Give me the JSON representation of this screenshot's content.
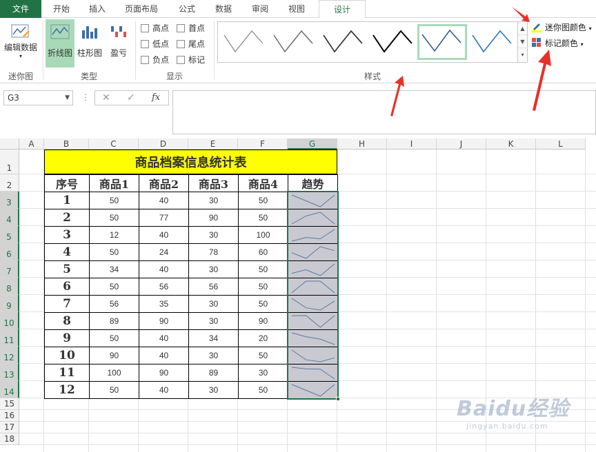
{
  "tabs": [
    "文件",
    "开始",
    "插入",
    "页面布局",
    "公式",
    "数据",
    "审阅",
    "视图",
    "设计"
  ],
  "ribbon": {
    "edit_data": "编辑数据",
    "sparkline_group": "迷你图",
    "type_group": "类型",
    "type_buttons": [
      "折线图",
      "柱形图",
      "盈亏"
    ],
    "show_group": "显示",
    "show_checks": [
      "高点",
      "首点",
      "低点",
      "尾点",
      "负点",
      "标记"
    ],
    "style_group": "样式",
    "sparkline_color": "迷你图颜色",
    "marker_color": "标记颜色"
  },
  "formula_bar": {
    "name_box": "G3",
    "fx": "fx"
  },
  "columns": [
    "A",
    "B",
    "C",
    "D",
    "E",
    "F",
    "G",
    "H",
    "I",
    "J",
    "K",
    "L"
  ],
  "rows": [
    "1",
    "2",
    "3",
    "4",
    "5",
    "6",
    "7",
    "8",
    "9",
    "10",
    "11",
    "12",
    "13",
    "14",
    "15",
    "16",
    "17",
    "18"
  ],
  "table": {
    "title": "商品档案信息统计表",
    "headers": [
      "序号",
      "商品1",
      "商品2",
      "商品3",
      "商品4",
      "趋势"
    ],
    "rows": [
      {
        "seq": "1",
        "v": [
          50,
          40,
          30,
          50
        ]
      },
      {
        "seq": "2",
        "v": [
          50,
          77,
          90,
          50
        ]
      },
      {
        "seq": "3",
        "v": [
          12,
          40,
          30,
          100
        ]
      },
      {
        "seq": "4",
        "v": [
          50,
          24,
          78,
          60
        ]
      },
      {
        "seq": "5",
        "v": [
          34,
          40,
          30,
          50
        ]
      },
      {
        "seq": "6",
        "v": [
          50,
          56,
          56,
          50
        ]
      },
      {
        "seq": "7",
        "v": [
          56,
          35,
          30,
          50
        ]
      },
      {
        "seq": "8",
        "v": [
          89,
          90,
          30,
          90
        ]
      },
      {
        "seq": "9",
        "v": [
          50,
          40,
          34,
          20
        ]
      },
      {
        "seq": "10",
        "v": [
          90,
          40,
          30,
          50
        ]
      },
      {
        "seq": "11",
        "v": [
          100,
          90,
          89,
          30
        ]
      },
      {
        "seq": "12",
        "v": [
          50,
          40,
          30,
          50
        ]
      }
    ]
  },
  "colors": {
    "accent": "#217346",
    "title_fill": "#ffff00",
    "sparkline": "#5b7a9e",
    "arrow": "#e8312b"
  },
  "watermark": {
    "main": "Baidu经验",
    "sub": "jingyan.baidu.com"
  }
}
